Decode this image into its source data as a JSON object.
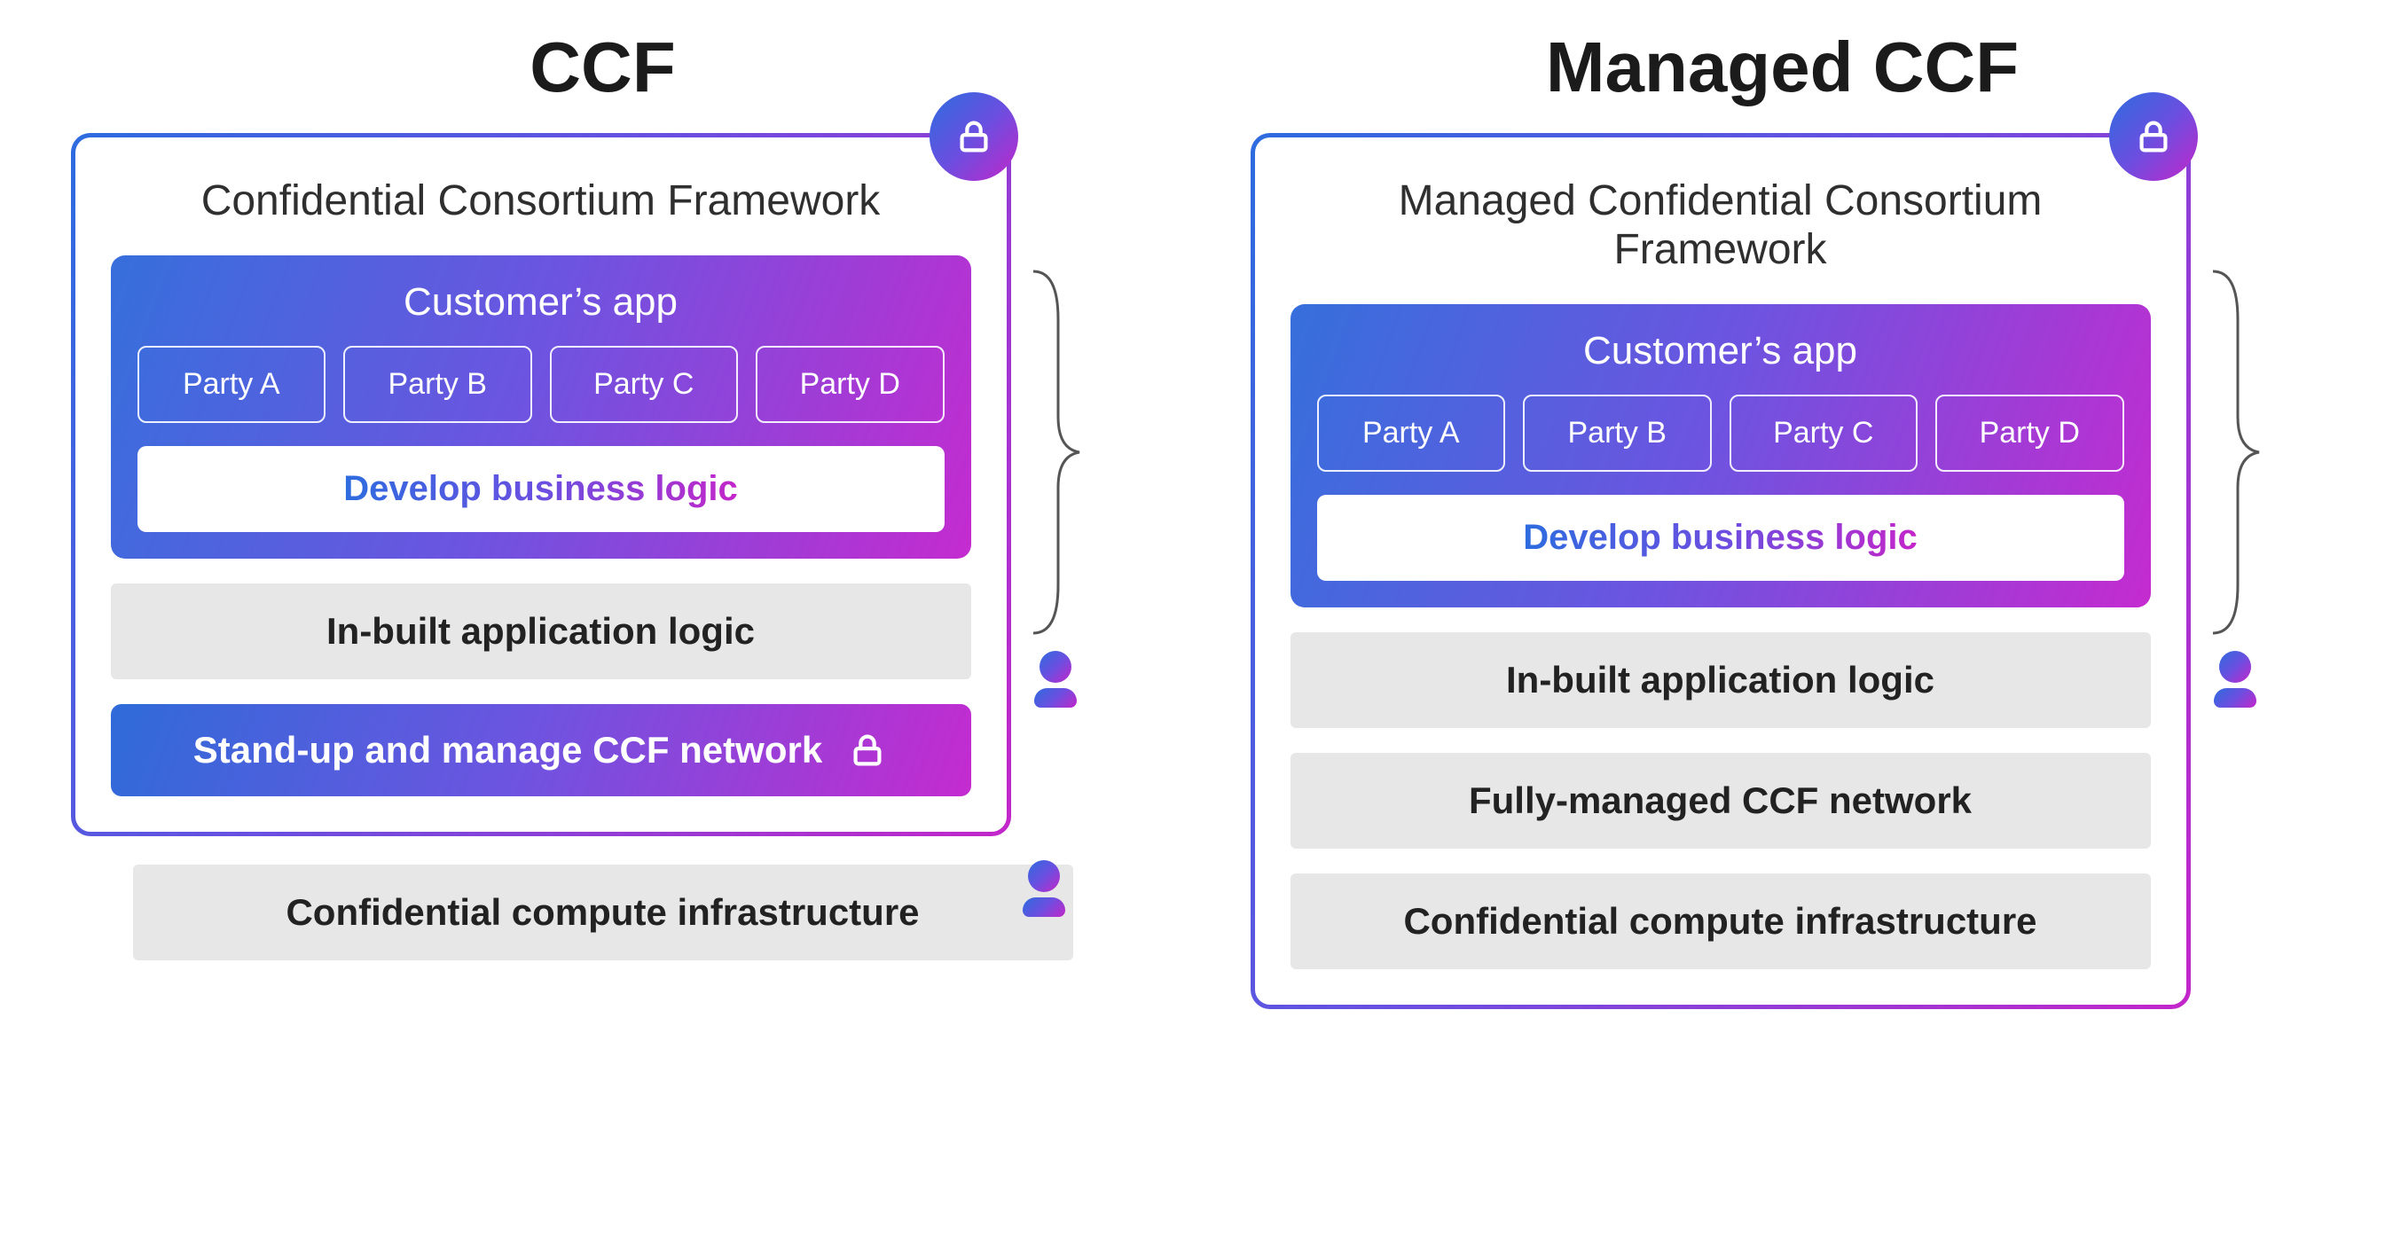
{
  "left": {
    "title": "CCF",
    "panel_heading": "Confidential Consortium Framework",
    "app_title": "Customer’s app",
    "parties": [
      "Party A",
      "Party B",
      "Party C",
      "Party D"
    ],
    "develop_label": "Develop business logic",
    "inbuilt_label": "In-built application logic",
    "standup_label": "Stand-up and manage CCF network",
    "outer_label": "Confidential compute infrastructure"
  },
  "right": {
    "title": "Managed CCF",
    "panel_heading": "Managed Confidential Consortium Framework",
    "app_title": "Customer’s app",
    "parties": [
      "Party A",
      "Party B",
      "Party C",
      "Party D"
    ],
    "develop_label": "Develop business logic",
    "inbuilt_label": "In-built application logic",
    "managed_label": "Fully-managed CCF network",
    "infra_label": "Confidential compute infrastructure"
  }
}
